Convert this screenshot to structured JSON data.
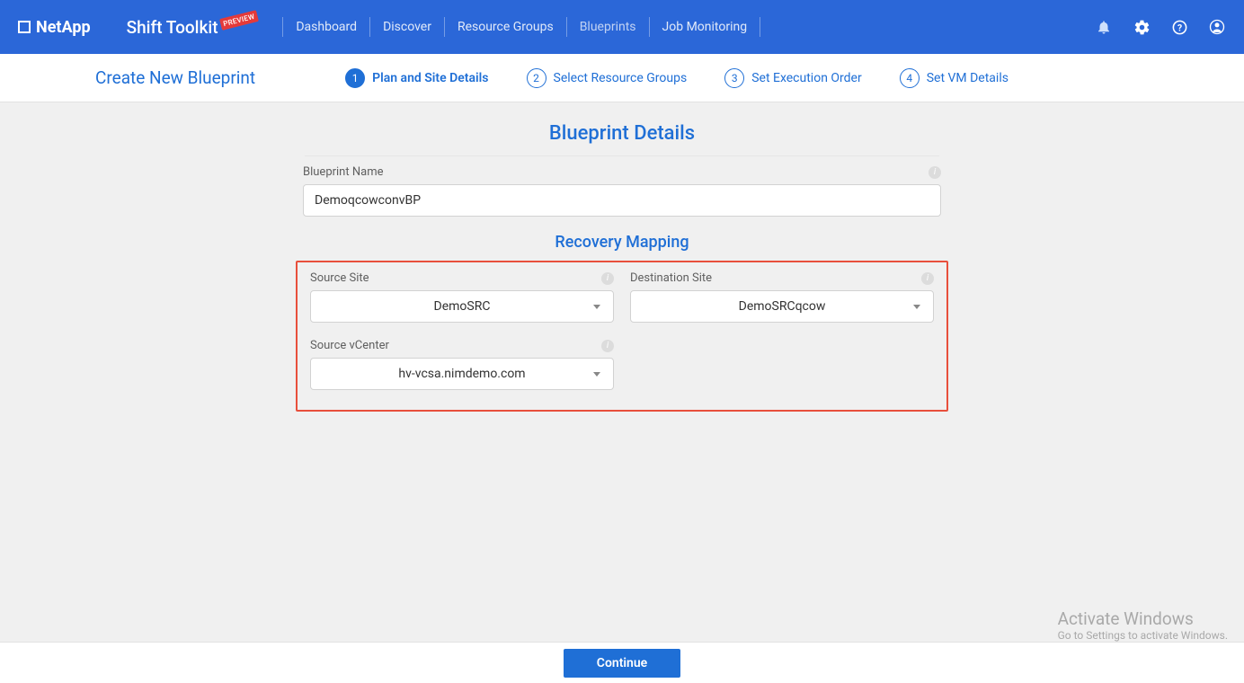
{
  "header": {
    "brand": "NetApp",
    "toolkit": "Shift Toolkit",
    "badge": "PREVIEW",
    "nav": {
      "dashboard": "Dashboard",
      "discover": "Discover",
      "resource_groups": "Resource Groups",
      "blueprints": "Blueprints",
      "job_monitoring": "Job Monitoring"
    }
  },
  "stepper": {
    "title": "Create New Blueprint",
    "s1": {
      "num": "1",
      "label": "Plan and Site Details"
    },
    "s2": {
      "num": "2",
      "label": "Select Resource Groups"
    },
    "s3": {
      "num": "3",
      "label": "Set Execution Order"
    },
    "s4": {
      "num": "4",
      "label": "Set VM Details"
    }
  },
  "form": {
    "details_title": "Blueprint Details",
    "blueprint_name_label": "Blueprint Name",
    "blueprint_name_value": "DemoqcowconvBP",
    "recovery_title": "Recovery Mapping",
    "source_site_label": "Source Site",
    "source_site_value": "DemoSRC",
    "dest_site_label": "Destination Site",
    "dest_site_value": "DemoSRCqcow",
    "source_vcenter_label": "Source vCenter",
    "source_vcenter_value": "hv-vcsa.nimdemo.com"
  },
  "footer": {
    "continue": "Continue"
  },
  "watermark": {
    "l1": "Activate Windows",
    "l2": "Go to Settings to activate Windows."
  }
}
